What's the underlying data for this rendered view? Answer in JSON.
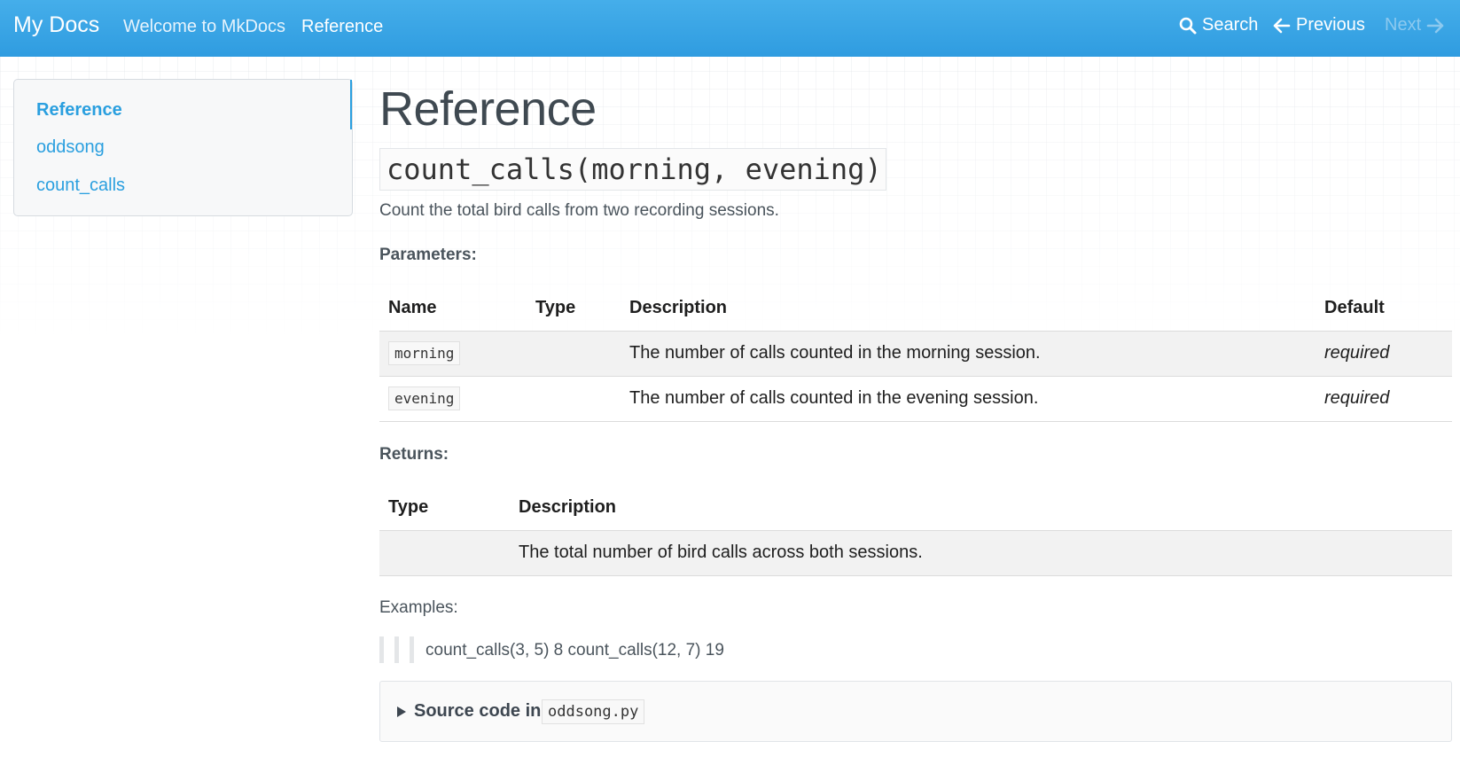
{
  "navbar": {
    "brand": "My Docs",
    "links": [
      "Welcome to MkDocs",
      "Reference"
    ],
    "search": "Search",
    "previous": "Previous",
    "next": "Next",
    "bg_color": "#3aa5e5"
  },
  "sidebar": {
    "items": [
      "Reference",
      "oddsong",
      "count_calls"
    ]
  },
  "main": {
    "title": "Reference",
    "signature": "count_calls(morning, evening)",
    "description": "Count the total bird calls from two recording sessions.",
    "parameters_label": "Parameters:",
    "parameters_table": {
      "headers": [
        "Name",
        "Type",
        "Description",
        "Default"
      ],
      "rows": [
        {
          "name": "morning",
          "type": "",
          "description": "The number of calls counted in the morning session.",
          "default": "required"
        },
        {
          "name": "evening",
          "type": "",
          "description": "The number of calls counted in the evening session.",
          "default": "required"
        }
      ]
    },
    "returns_label": "Returns:",
    "returns_table": {
      "headers": [
        "Type",
        "Description"
      ],
      "rows": [
        {
          "type": "",
          "description": "The total number of bird calls across both sessions."
        }
      ]
    },
    "examples_label": "Examples:",
    "example_text": "count_calls(3, 5) 8 count_calls(12, 7) 19",
    "source_label": "Source code in",
    "source_file": "oddsong.py"
  }
}
